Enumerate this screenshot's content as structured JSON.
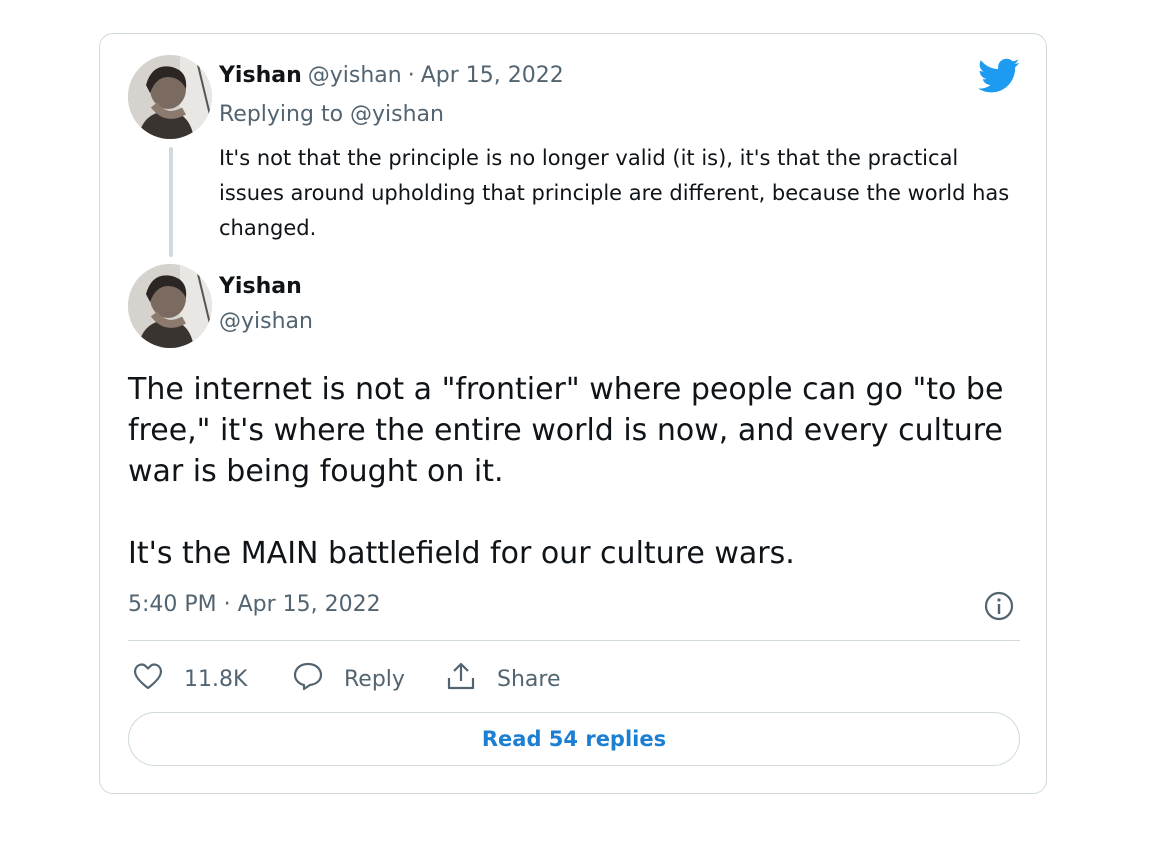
{
  "colors": {
    "accent": "#1d9bf0",
    "link": "#1d7fd1",
    "text": "#0f1419",
    "muted": "#536471",
    "border": "#cfd9de"
  },
  "parent_tweet": {
    "author_name": "Yishan",
    "author_handle": "@yishan",
    "separator": "·",
    "date": "Apr 15, 2022",
    "replying_to": "Replying to @yishan",
    "text": "It's not that the principle is no longer valid (it is), it's that the practical issues around upholding that principle are different, because the world has changed."
  },
  "main_tweet": {
    "author_name": "Yishan",
    "author_handle": "@yishan",
    "text": "The internet is not a \"frontier\" where people can go \"to be free,\" it's where the entire world is now, and every culture war is being fought on it.\n\nIt's the MAIN battlefield for our culture wars.",
    "timestamp": "5:40 PM · Apr 15, 2022"
  },
  "actions": {
    "like_count": "11.8K",
    "reply_label": "Reply",
    "share_label": "Share"
  },
  "read_replies_label": "Read 54 replies",
  "icons": [
    "twitter-bird-icon",
    "info-icon",
    "heart-icon",
    "reply-bubble-icon",
    "share-icon"
  ]
}
